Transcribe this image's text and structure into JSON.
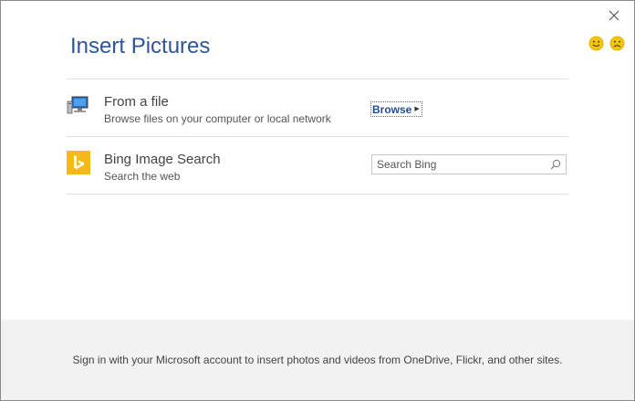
{
  "dialog": {
    "title": "Insert Pictures",
    "close_icon": "close-icon",
    "feedback": {
      "smile_icon": "smile-icon",
      "frown_icon": "frown-icon",
      "smile_color": "#f2c511",
      "frown_color": "#f2c511"
    }
  },
  "sources": [
    {
      "icon": "computer-icon",
      "title": "From a file",
      "subtitle": "Browse files on your computer or local network",
      "action_label": "Browse"
    },
    {
      "icon": "bing-logo-icon",
      "title": "Bing Image Search",
      "subtitle": "Search the web",
      "search_placeholder": "Search Bing",
      "search_value": "",
      "bing_color": "#f5b91b"
    }
  ],
  "footer": {
    "text": "Sign in with your Microsoft account to insert photos and videos from OneDrive, Flickr, and other sites."
  },
  "colors": {
    "title": "#2b5797",
    "link": "#1f4f9a",
    "footer_bg": "#f2f2f2"
  }
}
